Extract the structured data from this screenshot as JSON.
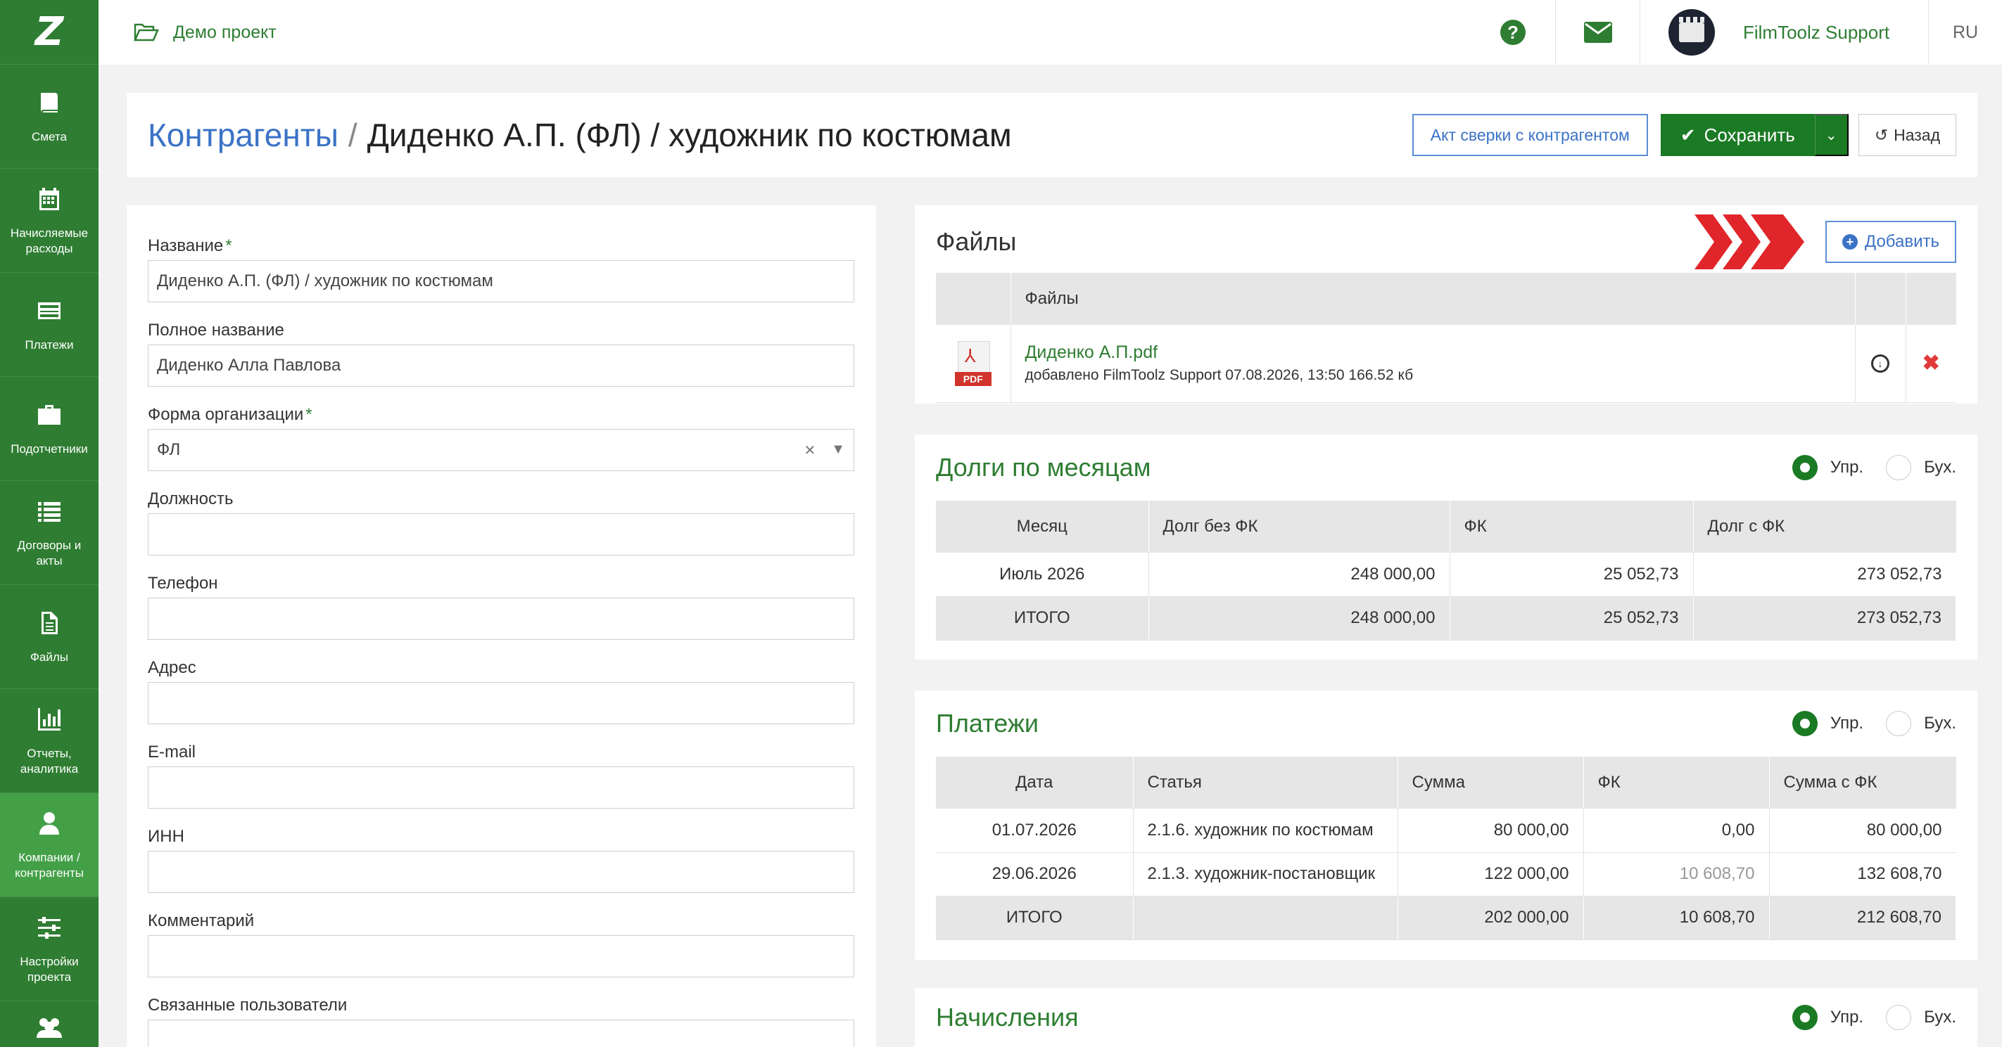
{
  "sidebar": {
    "logo": "Z",
    "items": [
      {
        "label": "Смета",
        "icon": "book-icon"
      },
      {
        "label": "Начисляемые расходы",
        "icon": "calendar-icon"
      },
      {
        "label": "Платежи",
        "icon": "credit-card-icon"
      },
      {
        "label": "Подотчетники",
        "icon": "briefcase-icon"
      },
      {
        "label": "Договоры и акты",
        "icon": "list-icon"
      },
      {
        "label": "Файлы",
        "icon": "file-icon"
      },
      {
        "label": "Отчеты, аналитика",
        "icon": "bar-chart-icon"
      },
      {
        "label": "Компании / контрагенты",
        "icon": "user-icon",
        "active": true
      },
      {
        "label": "Настройки проекта",
        "icon": "sliders-icon"
      },
      {
        "label": "",
        "icon": "users-icon"
      }
    ]
  },
  "topbar": {
    "project_name": "Демо проект",
    "user_name": "FilmToolz Support",
    "language": "RU"
  },
  "header": {
    "breadcrumb_root": "Контрагенты",
    "separator": "/",
    "title": "Диденко А.П. (ФЛ) / художник по костюмам",
    "reconciliation_button": "Акт сверки с контрагентом",
    "save_button": "Сохранить",
    "back_button": "Назад"
  },
  "form": {
    "name_label": "Название",
    "name_value": "Диденко А.П. (ФЛ) / художник по костюмам",
    "full_name_label": "Полное название",
    "full_name_value": "Диденко Алла Павлова",
    "org_form_label": "Форма организации",
    "org_form_value": "ФЛ",
    "position_label": "Должность",
    "phone_label": "Телефон",
    "address_label": "Адрес",
    "email_label": "E-mail",
    "inn_label": "ИНН",
    "comment_label": "Комментарий",
    "linked_users_label": "Связанные пользователи"
  },
  "files": {
    "title": "Файлы",
    "add_button": "Добавить",
    "column": "Файлы",
    "items": [
      {
        "name": "Диденко А.П.pdf",
        "meta": "добавлено FilmToolz Support 07.08.2026, 13:50 166.52 кб",
        "type": "PDF"
      }
    ]
  },
  "debts": {
    "title": "Долги по месяцам",
    "radio_mgmt": "Упр.",
    "radio_acc": "Бух.",
    "columns": [
      "Месяц",
      "Долг без ФК",
      "ФК",
      "Долг с ФК"
    ],
    "rows": [
      [
        "Июль 2026",
        "248 000,00",
        "25 052,73",
        "273 052,73"
      ]
    ],
    "total": [
      "ИТОГО",
      "248 000,00",
      "25 052,73",
      "273 052,73"
    ]
  },
  "payments": {
    "title": "Платежи",
    "radio_mgmt": "Упр.",
    "radio_acc": "Бух.",
    "columns": [
      "Дата",
      "Статья",
      "Сумма",
      "ФК",
      "Сумма с ФК"
    ],
    "rows": [
      [
        "01.07.2026",
        "2.1.6. художник по костюмам",
        "80 000,00",
        "0,00",
        "80 000,00"
      ],
      [
        "29.06.2026",
        "2.1.3. художник-постановщик",
        "122 000,00",
        "10 608,70",
        "132 608,70"
      ]
    ],
    "total": [
      "ИТОГО",
      "",
      "202 000,00",
      "10 608,70",
      "212 608,70"
    ]
  },
  "accruals": {
    "title": "Начисления",
    "radio_mgmt": "Упр.",
    "radio_acc": "Бух."
  },
  "colors": {
    "sidebar": "#2f7d32",
    "active": "#43a047",
    "brand_green": "#2e7d32",
    "link_blue": "#3b72c6",
    "danger": "#e23a3a"
  }
}
